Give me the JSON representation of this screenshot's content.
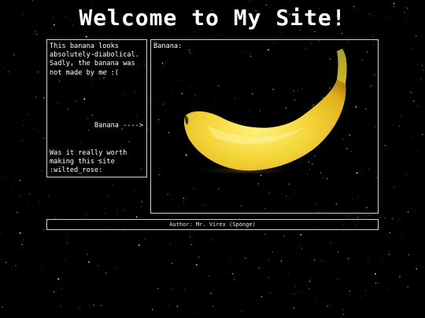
{
  "header": {
    "title": "Welcome to My Site!"
  },
  "sidebar": {
    "message_top": "This banana looks absolutely diabolical. Sadly, the banana was not made by me :(",
    "banana_link": "Banana ---->",
    "message_bottom": "Was it really worth making this site :wilted_rose:"
  },
  "main": {
    "label": "Banana:",
    "image_icon": "banana-image"
  },
  "footer": {
    "author": "Author: Mr. Virex (Sponge)"
  },
  "colors": {
    "background": "#000000",
    "text": "#ffffff",
    "border": "#cfcfcf",
    "banana_yellow": "#f3d43a",
    "banana_shadow": "#c99a16"
  }
}
